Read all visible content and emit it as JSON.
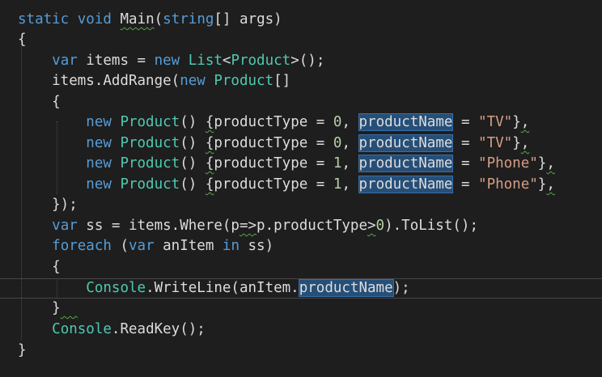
{
  "editor": {
    "theme_colors": {
      "background": "#1e1e1e",
      "keyword": "#569cd6",
      "type": "#4ec9b0",
      "string": "#d69d85",
      "number": "#b5cea8",
      "text": "#dcdcdc",
      "selection": "#264f78"
    },
    "lines": [
      {
        "id": "l1",
        "tokens": [
          [
            "kw",
            "static"
          ],
          [
            "pl",
            " "
          ],
          [
            "kw",
            "void"
          ],
          [
            "pl",
            " "
          ],
          [
            "pl squig",
            "Main"
          ],
          [
            "pl",
            "("
          ],
          [
            "kw",
            "string"
          ],
          [
            "pl",
            "[] "
          ],
          [
            "pl",
            "args"
          ],
          [
            "pl",
            ")"
          ]
        ]
      },
      {
        "id": "l2",
        "tokens": [
          [
            "pl",
            "{"
          ]
        ]
      },
      {
        "id": "l3",
        "tokens": [
          [
            "pl",
            "    "
          ],
          [
            "kw",
            "var"
          ],
          [
            "pl",
            " items = "
          ],
          [
            "kw",
            "new"
          ],
          [
            "pl",
            " "
          ],
          [
            "ty",
            "List"
          ],
          [
            "pl",
            "<"
          ],
          [
            "ty",
            "Product"
          ],
          [
            "pl",
            ">();"
          ]
        ]
      },
      {
        "id": "l4",
        "tokens": [
          [
            "pl",
            "    items.AddRange("
          ],
          [
            "kw",
            "new"
          ],
          [
            "pl",
            " "
          ],
          [
            "ty",
            "Product"
          ],
          [
            "pl",
            "[]"
          ]
        ]
      },
      {
        "id": "l5",
        "tokens": [
          [
            "pl",
            "    {"
          ]
        ]
      },
      {
        "id": "l6",
        "tokens": [
          [
            "pl",
            "        "
          ],
          [
            "kw",
            "new"
          ],
          [
            "pl",
            " "
          ],
          [
            "ty",
            "Product"
          ],
          [
            "pl",
            "() "
          ],
          [
            "pl squig",
            "{"
          ],
          [
            "pl",
            "productType = "
          ],
          [
            "nm",
            "0"
          ],
          [
            "pl",
            ", "
          ],
          [
            "pl hl",
            "productName"
          ],
          [
            "pl",
            " = "
          ],
          [
            "st",
            "\"TV\""
          ],
          [
            "pl",
            "}"
          ],
          [
            "pl squig",
            ","
          ]
        ]
      },
      {
        "id": "l7",
        "tokens": [
          [
            "pl",
            "        "
          ],
          [
            "kw",
            "new"
          ],
          [
            "pl",
            " "
          ],
          [
            "ty",
            "Product"
          ],
          [
            "pl",
            "() "
          ],
          [
            "pl squig",
            "{"
          ],
          [
            "pl",
            "productType = "
          ],
          [
            "nm",
            "0"
          ],
          [
            "pl",
            ", "
          ],
          [
            "pl hl",
            "productName"
          ],
          [
            "pl",
            " = "
          ],
          [
            "st",
            "\"TV\""
          ],
          [
            "pl",
            "}"
          ],
          [
            "pl squig",
            ","
          ]
        ]
      },
      {
        "id": "l8",
        "tokens": [
          [
            "pl",
            "        "
          ],
          [
            "kw",
            "new"
          ],
          [
            "pl",
            " "
          ],
          [
            "ty",
            "Product"
          ],
          [
            "pl",
            "() "
          ],
          [
            "pl squig",
            "{"
          ],
          [
            "pl",
            "productType = "
          ],
          [
            "nm",
            "1"
          ],
          [
            "pl",
            ", "
          ],
          [
            "pl hl",
            "productName"
          ],
          [
            "pl",
            " = "
          ],
          [
            "st",
            "\"Phone\""
          ],
          [
            "pl",
            "}"
          ],
          [
            "pl squig",
            ","
          ]
        ]
      },
      {
        "id": "l9",
        "tokens": [
          [
            "pl",
            "        "
          ],
          [
            "kw",
            "new"
          ],
          [
            "pl",
            " "
          ],
          [
            "ty",
            "Product"
          ],
          [
            "pl",
            "() "
          ],
          [
            "pl squig",
            "{"
          ],
          [
            "pl",
            "productType = "
          ],
          [
            "nm",
            "1"
          ],
          [
            "pl",
            ", "
          ],
          [
            "pl hl",
            "productName"
          ],
          [
            "pl",
            " = "
          ],
          [
            "st",
            "\"Phone\""
          ],
          [
            "pl",
            "}"
          ],
          [
            "pl squig",
            ","
          ]
        ]
      },
      {
        "id": "l10",
        "tokens": [
          [
            "pl",
            "    });"
          ]
        ]
      },
      {
        "id": "l11",
        "tokens": [
          [
            "pl",
            "    "
          ],
          [
            "kw",
            "var"
          ],
          [
            "pl",
            " ss = items.Where(p"
          ],
          [
            "pl squig",
            "=>"
          ],
          [
            "pl",
            "p.productType"
          ],
          [
            "pl squig",
            ">"
          ],
          [
            "nm",
            "0"
          ],
          [
            "pl",
            ").ToList();"
          ]
        ]
      },
      {
        "id": "l12",
        "tokens": [
          [
            "pl",
            "    "
          ],
          [
            "kw",
            "foreach"
          ],
          [
            "pl",
            " ("
          ],
          [
            "kw",
            "var"
          ],
          [
            "pl",
            " anItem "
          ],
          [
            "kw",
            "in"
          ],
          [
            "pl",
            " ss)"
          ]
        ]
      },
      {
        "id": "l13",
        "tokens": [
          [
            "pl",
            "    {"
          ]
        ]
      },
      {
        "id": "l14",
        "tokens": [
          [
            "pl",
            "        "
          ],
          [
            "ty",
            "Console"
          ],
          [
            "pl",
            ".WriteLine(anItem."
          ],
          [
            "pl hl",
            "productName"
          ],
          [
            "pl",
            ");"
          ]
        ]
      },
      {
        "id": "l15",
        "tokens": [
          [
            "pl",
            "    }"
          ],
          [
            "pl squig",
            "  "
          ]
        ]
      },
      {
        "id": "l16",
        "tokens": [
          [
            "pl",
            "    "
          ],
          [
            "ty",
            "Console"
          ],
          [
            "pl",
            ".ReadKey();"
          ]
        ]
      },
      {
        "id": "l17",
        "tokens": [
          [
            "pl",
            "}"
          ]
        ]
      }
    ]
  }
}
